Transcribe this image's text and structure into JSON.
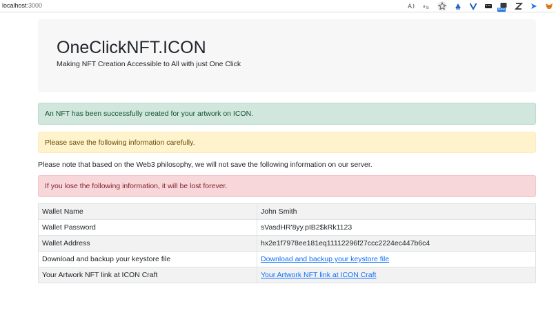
{
  "browser": {
    "url_host": "localhost",
    "url_port": ":3000",
    "new_badge": "New",
    "icons": [
      "read-aloud-icon",
      "translate-icon",
      "favorite-icon",
      "extension-1-icon",
      "extension-v-icon",
      "extension-keyboard-icon",
      "extension-new-icon",
      "extension-z-icon",
      "extension-arrow-icon",
      "metamask-icon"
    ]
  },
  "header": {
    "title": "OneClickNFT.ICON",
    "subtitle": "Making NFT Creation Accessible to All with just One Click"
  },
  "alerts": {
    "success": "An NFT has been successfully created for your artwork on ICON.",
    "warning": "Please save the following information carefully.",
    "note": "Please note that based on the Web3 philosophy, we will not save the following information on our server.",
    "danger": "If you lose the following information, it will be lost forever."
  },
  "table": {
    "rows": [
      {
        "label": "Wallet Name",
        "value": "John Smith"
      },
      {
        "label": "Wallet Password",
        "value": "sVasdHR'8yy.pIB2$kRk1123"
      },
      {
        "label": "Wallet Address",
        "value": "hx2e1f7978ee181eq11112296f27ccc2224ec447b6c4"
      },
      {
        "label": "Download and backup your keystore file",
        "value": "Download and backup your keystore file"
      },
      {
        "label": "Your Artwork NFT link at ICON Craft",
        "value": "Your Artwork NFT link at ICON Craft"
      }
    ]
  },
  "colors": {
    "success_bg": "#d1e7dd",
    "warning_bg": "#fff3cd",
    "danger_bg": "#f8d7da",
    "link": "#0d6efd"
  }
}
